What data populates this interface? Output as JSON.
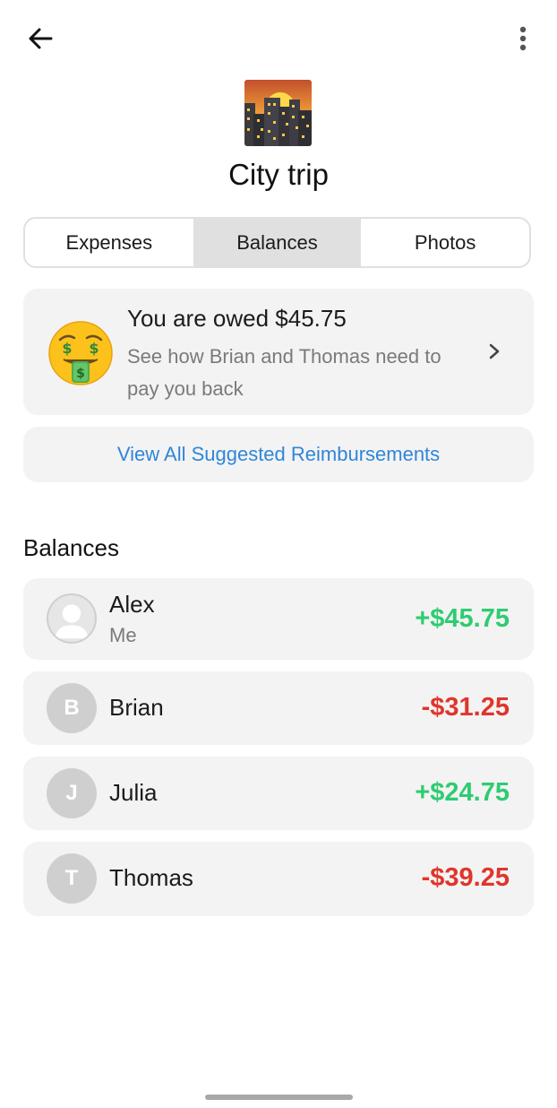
{
  "header": {
    "back_icon": "arrow-left-icon",
    "more_icon": "more-vertical-icon"
  },
  "group": {
    "image": "city-sunset-image",
    "title": "City trip"
  },
  "tabs": [
    {
      "label": "Expenses",
      "active": false
    },
    {
      "label": "Balances",
      "active": true
    },
    {
      "label": "Photos",
      "active": false
    }
  ],
  "summary": {
    "emoji": "money-mouth-face-icon",
    "title": "You are owed $45.75",
    "subtitle": "See how Brian and Thomas need to pay you back",
    "chevron_icon": "chevron-right-icon"
  },
  "reimbursements": {
    "label": "View All Suggested Reimbursements"
  },
  "balances": {
    "title": "Balances",
    "rows": [
      {
        "name": "Alex",
        "sub": "Me",
        "initial": "",
        "amount": "+$45.75",
        "sign": "positive"
      },
      {
        "name": "Brian",
        "sub": "",
        "initial": "B",
        "amount": "-$31.25",
        "sign": "negative"
      },
      {
        "name": "Julia",
        "sub": "",
        "initial": "J",
        "amount": "+$24.75",
        "sign": "positive"
      },
      {
        "name": "Thomas",
        "sub": "",
        "initial": "T",
        "amount": "-$39.25",
        "sign": "negative"
      }
    ]
  },
  "colors": {
    "positive": "#2ecc71",
    "negative": "#e0352b",
    "link": "#2f86d8"
  }
}
